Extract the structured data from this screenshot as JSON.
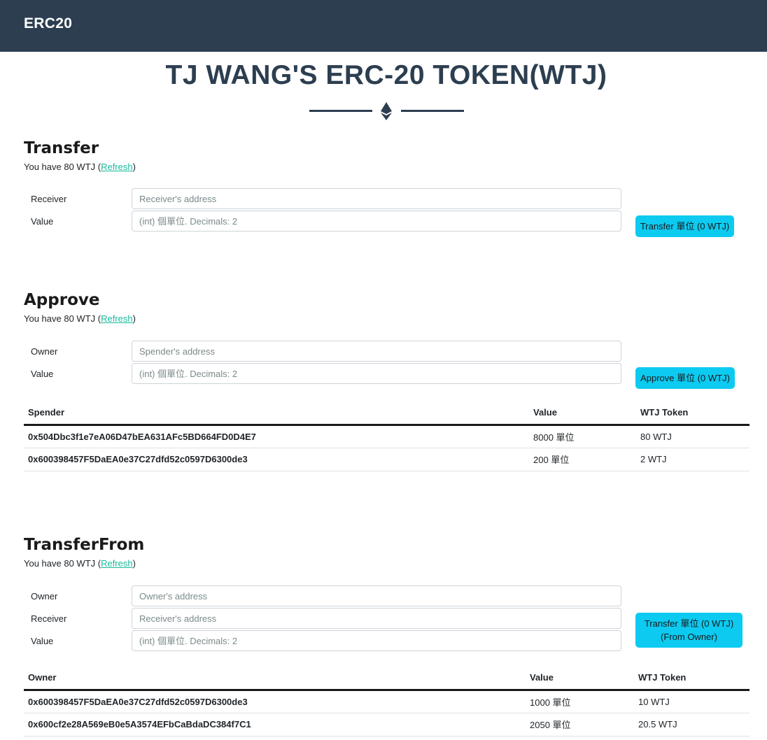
{
  "navbar": {
    "brand": "ERC20"
  },
  "header": {
    "title": "TJ WANG'S ERC-20 TOKEN(WTJ)"
  },
  "transfer": {
    "title": "Transfer",
    "balance_prefix": "You have 80 WTJ (",
    "refresh_label": "Refresh",
    "balance_suffix": ")",
    "receiver_label": "Receiver",
    "receiver_placeholder": "Receiver's address",
    "value_label": "Value",
    "value_placeholder": "(int) 個單位. Decimals: 2",
    "button_label": "Transfer 單位 (0 WTJ)"
  },
  "approve": {
    "title": "Approve",
    "balance_prefix": "You have 80 WTJ (",
    "refresh_label": "Refresh",
    "balance_suffix": ")",
    "owner_label": "Owner",
    "owner_placeholder": "Spender's address",
    "value_label": "Value",
    "value_placeholder": "(int) 個單位. Decimals: 2",
    "button_label": "Approve 單位 (0 WTJ)",
    "table": {
      "headers": [
        "Spender",
        "Value",
        "WTJ Token"
      ],
      "rows": [
        [
          "0x504Dbc3f1e7eA06D47bEA631AFc5BD664FD0D4E7",
          "8000 單位",
          "80 WTJ"
        ],
        [
          "0x600398457F5DaEA0e37C27dfd52c0597D6300de3",
          "200 單位",
          "2 WTJ"
        ]
      ]
    }
  },
  "transfer_from": {
    "title": "TransferFrom",
    "balance_prefix": "You have 80 WTJ (",
    "refresh_label": "Refresh",
    "balance_suffix": ")",
    "owner_label": "Owner",
    "owner_placeholder": "Owner's address",
    "receiver_label": "Receiver",
    "receiver_placeholder": "Receiver's address",
    "value_label": "Value",
    "value_placeholder": "(int) 個單位. Decimals: 2",
    "button_line1": "Transfer 單位 (0 WTJ)",
    "button_line2": "(From Owner)",
    "table": {
      "headers": [
        "Owner",
        "Value",
        "WTJ Token"
      ],
      "rows": [
        [
          "0x600398457F5DaEA0e37C27dfd52c0597D6300de3",
          "1000 單位",
          "10 WTJ"
        ],
        [
          "0x600cf2e28A569eB0e5A3574EFbCaBdaDC384f7C1",
          "2050 單位",
          "20.5 WTJ"
        ]
      ]
    }
  },
  "colors": {
    "navbar": "#2c3e50",
    "accent_button": "#0dcaf0",
    "link": "#18bc9c"
  },
  "icons": {
    "divider": "ethereum-icon"
  }
}
